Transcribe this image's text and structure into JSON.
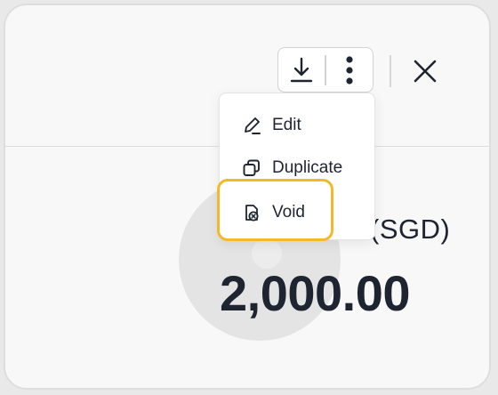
{
  "toolbar": {
    "download_icon": "download-icon",
    "more_icon": "more-vertical-icon",
    "close_icon": "close-icon"
  },
  "menu": {
    "items": [
      {
        "label": "Edit",
        "icon": "edit-pencil-icon"
      },
      {
        "label": "Duplicate",
        "icon": "duplicate-icon"
      },
      {
        "label": "Void",
        "icon": "void-document-icon",
        "highlighted": true
      }
    ]
  },
  "summary": {
    "currency_label": "(SGD)",
    "amount": "2,000.00"
  },
  "colors": {
    "highlight": "#f2b92a",
    "text": "#1e2430",
    "card_background": "#f8f8f8"
  }
}
